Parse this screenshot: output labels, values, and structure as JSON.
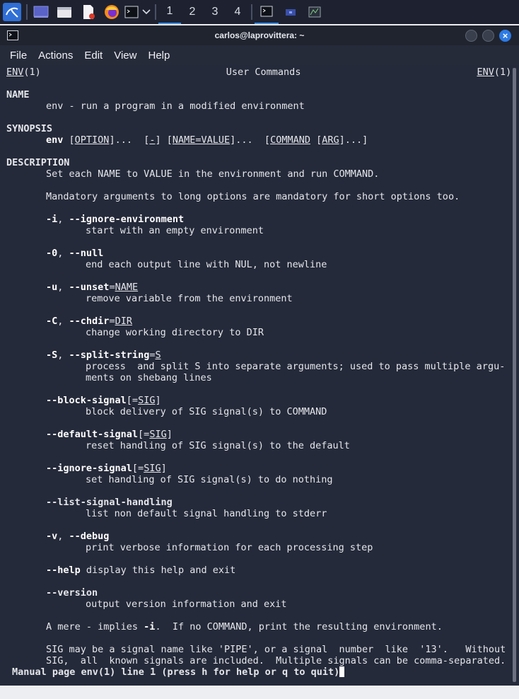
{
  "taskbar": {
    "workspaces": [
      "1",
      "2",
      "3",
      "4"
    ],
    "active_workspace": "1",
    "icons": [
      "kali-menu-icon",
      "desktop-icon",
      "files-icon",
      "text-editor-icon",
      "firefox-icon",
      "terminal-icon"
    ]
  },
  "window": {
    "title": "carlos@laprovittera: ~",
    "menu": [
      "File",
      "Actions",
      "Edit",
      "View",
      "Help"
    ]
  },
  "man": {
    "header_left_name": "ENV",
    "header_left_sect": "(1)",
    "header_center": "User Commands",
    "header_right_name": "ENV",
    "header_right_sect": "(1)",
    "name_heading": "NAME",
    "name_text": "env - run a program in a modified environment",
    "synopsis_heading": "SYNOPSIS",
    "synopsis": {
      "cmd": "env",
      "option": "OPTION",
      "dash": "-",
      "namevalue": "NAME=VALUE",
      "command": "COMMAND",
      "arg": "ARG"
    },
    "description_heading": "DESCRIPTION",
    "desc1": "Set each NAME to VALUE in the environment and run COMMAND.",
    "desc2": "Mandatory arguments to long options are mandatory for short options too.",
    "opt_i": {
      "flag": "-i",
      "sep": ", ",
      "long": "--ignore-environment",
      "desc": "start with an empty environment"
    },
    "opt_0": {
      "flag": "-0",
      "sep": ", ",
      "long": "--null",
      "desc": "end each output line with NUL, not newline"
    },
    "opt_u": {
      "flag": "-u",
      "sep": ", ",
      "long": "--unset",
      "eq": "=",
      "arg": "NAME",
      "desc": "remove variable from the environment"
    },
    "opt_C": {
      "flag": "-C",
      "sep": ", ",
      "long": "--chdir",
      "eq": "=",
      "arg": "DIR",
      "desc": "change working directory to DIR"
    },
    "opt_S": {
      "flag": "-S",
      "sep": ", ",
      "long": "--split-string",
      "eq": "=",
      "arg": "S",
      "desc1": "process  and split S into separate arguments; used to pass multiple argu-",
      "desc2": "ments on shebang lines"
    },
    "opt_block": {
      "long": "--block-signal",
      "open": "[=",
      "arg": "SIG",
      "close": "]",
      "desc": "block delivery of SIG signal(s) to COMMAND"
    },
    "opt_default": {
      "long": "--default-signal",
      "open": "[=",
      "arg": "SIG",
      "close": "]",
      "desc": "reset handling of SIG signal(s) to the default"
    },
    "opt_ignore": {
      "long": "--ignore-signal",
      "open": "[=",
      "arg": "SIG",
      "close": "]",
      "desc": "set handling of SIG signal(s) to do nothing"
    },
    "opt_list": {
      "long": "--list-signal-handling",
      "desc": "list non default signal handling to stderr"
    },
    "opt_v": {
      "flag": "-v",
      "sep": ", ",
      "long": "--debug",
      "desc": "print verbose information for each processing step"
    },
    "opt_help": {
      "long": "--help",
      "desc": " display this help and exit"
    },
    "opt_version": {
      "long": "--version",
      "desc": "output version information and exit"
    },
    "mere_pre": "A mere - implies ",
    "mere_flag": "-i",
    "mere_post": ".  If no COMMAND, print the resulting environment.",
    "sig1": "SIG may be a signal name like 'PIPE', or a signal  number  like  '13'.   Without",
    "sig2": "SIG,  all  known signals are included.  Multiple signals can be comma-separated.",
    "status": "Manual page env(1) line 1 (press h for help or q to quit)"
  },
  "colors": {
    "terminal_bg": "#252a3a",
    "status_text": "#e6862a",
    "accent": "#2d7be5"
  }
}
